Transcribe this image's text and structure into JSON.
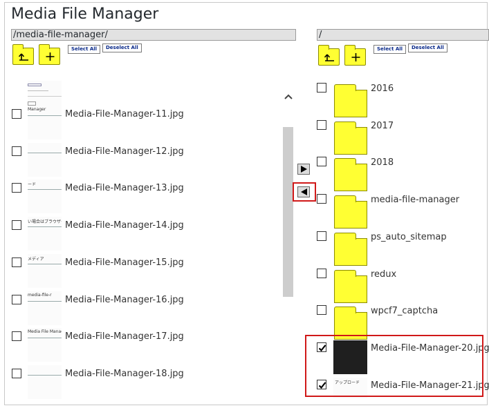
{
  "app": {
    "title": "Media File Manager"
  },
  "left": {
    "path": "/media-file-manager/",
    "select_all": "Select All",
    "deselect_all": "Deselect All",
    "files": [
      {
        "name": "Media-File-Manager-11.jpg",
        "checked": false,
        "thumb_text": "Manager"
      },
      {
        "name": "Media-File-Manager-12.jpg",
        "checked": false,
        "thumb_text": ""
      },
      {
        "name": "Media-File-Manager-13.jpg",
        "checked": false,
        "thumb_text": "ード"
      },
      {
        "name": "Media-File-Manager-14.jpg",
        "checked": false,
        "thumb_text": "い場合はブラウザーア"
      },
      {
        "name": "Media-File-Manager-15.jpg",
        "checked": false,
        "thumb_text": "メディア"
      },
      {
        "name": "Media-File-Manager-16.jpg",
        "checked": false,
        "thumb_text": "media-file-r"
      },
      {
        "name": "Media-File-Manager-17.jpg",
        "checked": false,
        "thumb_text": "Media File Manager"
      },
      {
        "name": "Media-File-Manager-18.jpg",
        "checked": false,
        "thumb_text": ""
      }
    ]
  },
  "right": {
    "path": "/",
    "select_all": "Select All",
    "deselect_all": "Deselect All",
    "folders": [
      {
        "name": "2016",
        "checked": false
      },
      {
        "name": "2017",
        "checked": false
      },
      {
        "name": "2018",
        "checked": false
      },
      {
        "name": "media-file-manager",
        "checked": false
      },
      {
        "name": "ps_auto_sitemap",
        "checked": false
      },
      {
        "name": "redux",
        "checked": false
      },
      {
        "name": "wpcf7_captcha",
        "checked": false
      }
    ],
    "files": [
      {
        "name": "Media-File-Manager-20.jpg",
        "checked": true,
        "thumb_text": ""
      },
      {
        "name": "Media-File-Manager-21.jpg",
        "checked": true,
        "thumb_text": "アップロード"
      }
    ]
  },
  "icons": {
    "up_folder": "folder-up-icon",
    "new_folder": "folder-plus-icon",
    "move_right": "triangle-right-icon",
    "move_left": "triangle-left-icon",
    "scroll_up": "chevron-up-icon"
  },
  "colors": {
    "folder": "#ffff33",
    "highlight": "#d01818",
    "link_blue": "#0a2a8a"
  }
}
